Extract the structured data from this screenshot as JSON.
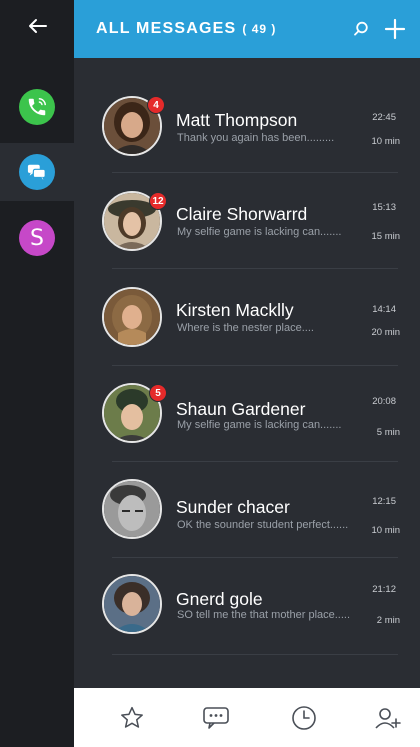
{
  "header": {
    "title": "ALL  MESSAGES",
    "count": "( 49 )"
  },
  "rail": {
    "items": [
      {
        "name": "phone",
        "color": "#3cc44c"
      },
      {
        "name": "chat",
        "color": "#2a9fd8"
      },
      {
        "name": "skype",
        "label": "S",
        "color": "#c648c8"
      }
    ]
  },
  "messages": [
    {
      "name": "Matt Thompson",
      "preview": "Thank you again has been.........",
      "time": "22:45",
      "duration": "10 min",
      "badge": "4",
      "avatar_bg": "#6b4f3a",
      "hair": "#3b2618",
      "skin": "#d7a98a"
    },
    {
      "name": "Claire Shorwarrd",
      "preview": "My selfie game is lacking can.......",
      "time": "15:13",
      "duration": "15 min",
      "badge": "12",
      "avatar_bg": "#c9b79f",
      "hair": "#4d3a28",
      "skin": "#e4c2a6"
    },
    {
      "name": "Kirsten Macklly",
      "preview": "Where is the nester place....",
      "time": "14:14",
      "duration": "20 min",
      "badge": "",
      "avatar_bg": "#7a5a3a",
      "hair": "#8c6a44",
      "skin": "#e0b08e"
    },
    {
      "name": "Shaun Gardener",
      "preview": "My selfie game is lacking can.......",
      "time": "20:08",
      "duration": "5 min",
      "badge": "5",
      "avatar_bg": "#6c7c4a",
      "hair": "#2b3a2a",
      "skin": "#e4bfa0"
    },
    {
      "name": "Sunder chacer",
      "preview": "OK the sounder student perfect......",
      "time": "12:15",
      "duration": "10 min",
      "badge": "",
      "avatar_bg": "#9a9a9a",
      "hair": "#3a3a3a",
      "skin": "#bdbdbd"
    },
    {
      "name": "Gnerd gole",
      "preview": "SO tell me the that mother place.....",
      "time": "21:12",
      "duration": "2 min",
      "badge": "",
      "avatar_bg": "#5b6f86",
      "hair": "#3a2e28",
      "skin": "#d9b39a"
    }
  ],
  "bottom_tabs": [
    "favorites",
    "messages",
    "recent",
    "add-contact"
  ]
}
